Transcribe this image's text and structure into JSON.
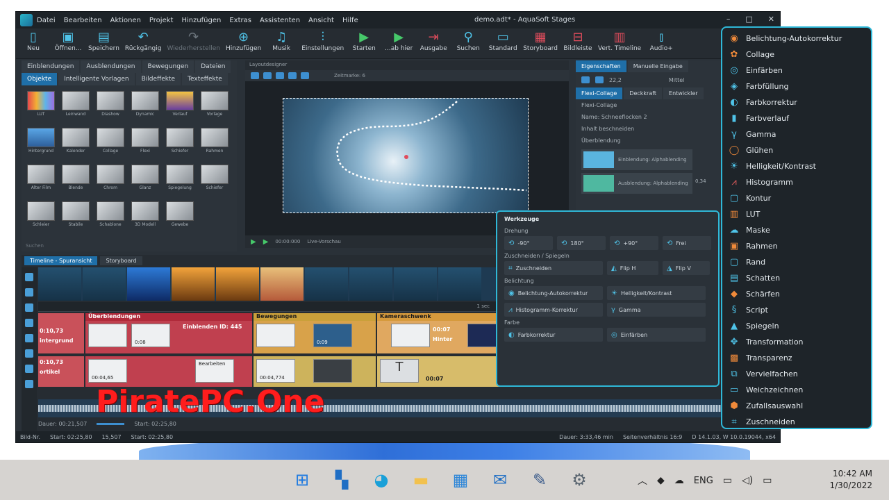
{
  "window": {
    "title": "demo.adt* - AquaSoft Stages",
    "menu": [
      "Datei",
      "Bearbeiten",
      "Aktionen",
      "Projekt",
      "Hinzufügen",
      "Extras",
      "Assistenten",
      "Ansicht",
      "Hilfe"
    ],
    "controls": [
      "–",
      "□",
      "✕"
    ]
  },
  "toolbar": [
    {
      "label": "Neu",
      "icon": "new-file-icon",
      "glyph": "▯"
    },
    {
      "label": "Öffnen...",
      "icon": "open-icon",
      "glyph": "▣"
    },
    {
      "label": "Speichern",
      "icon": "save-icon",
      "glyph": "▤"
    },
    {
      "label": "Rückgängig",
      "icon": "undo-icon",
      "glyph": "↶"
    },
    {
      "label": "Wiederherstellen",
      "icon": "redo-icon",
      "glyph": "↷",
      "dim": true
    },
    {
      "label": "Hinzufügen",
      "icon": "add-icon",
      "glyph": "⊕"
    },
    {
      "label": "Musik",
      "icon": "music-icon",
      "glyph": "♫"
    },
    {
      "label": "Einstellungen",
      "icon": "settings-icon",
      "glyph": "⫶"
    },
    {
      "label": "Starten",
      "icon": "play-icon",
      "glyph": "▶",
      "green": true
    },
    {
      "label": "...ab hier",
      "icon": "play-from-here-icon",
      "glyph": "▶",
      "green": true
    },
    {
      "label": "Ausgabe",
      "icon": "output-icon",
      "glyph": "⇥",
      "red": true
    },
    {
      "label": "Suchen",
      "icon": "search-icon",
      "glyph": "⚲"
    },
    {
      "label": "Standard",
      "icon": "standard-view-icon",
      "glyph": "▭"
    },
    {
      "label": "Storyboard",
      "icon": "storyboard-icon",
      "glyph": "▦",
      "red": true
    },
    {
      "label": "Bildleiste",
      "icon": "image-bar-icon",
      "glyph": "⊟",
      "red": true
    },
    {
      "label": "Vert. Timeline",
      "icon": "vertical-timeline-icon",
      "glyph": "▥",
      "red": true
    },
    {
      "label": "Audio+",
      "icon": "audio-plus-icon",
      "glyph": "⫾"
    }
  ],
  "object_panel": {
    "tabs_top": [
      "Einblendungen",
      "Ausblendungen",
      "Bewegungen",
      "Dateien"
    ],
    "tabs_bottom": [
      "Objekte",
      "Intelligente Vorlagen",
      "Bildeffekte",
      "Texteffekte"
    ],
    "active_tab": "Objekte",
    "thumbs": [
      {
        "label": "LUT",
        "style": "lut"
      },
      {
        "label": "Leinwand",
        "style": ""
      },
      {
        "label": "Diashow",
        "style": ""
      },
      {
        "label": "Dynamic",
        "style": ""
      },
      {
        "label": "Verlauf",
        "style": "sun"
      },
      {
        "label": "Vorlage",
        "style": ""
      },
      {
        "label": "Hintergrund",
        "style": "blue"
      },
      {
        "label": "Kalender",
        "style": ""
      },
      {
        "label": "Collage",
        "style": ""
      },
      {
        "label": "Flexi",
        "style": ""
      },
      {
        "label": "Schiefer",
        "style": ""
      },
      {
        "label": "Rahmen",
        "style": ""
      },
      {
        "label": "Alter Film",
        "style": ""
      },
      {
        "label": "Blende",
        "style": ""
      },
      {
        "label": "Chrom",
        "style": ""
      },
      {
        "label": "Glanz",
        "style": ""
      },
      {
        "label": "Spiegelung",
        "style": ""
      },
      {
        "label": "Schiefer",
        "style": ""
      },
      {
        "label": "Schleier",
        "style": ""
      },
      {
        "label": "Stabile",
        "style": ""
      },
      {
        "label": "Schablone",
        "style": ""
      },
      {
        "label": "3D Modell",
        "style": ""
      },
      {
        "label": "Gewebe",
        "style": ""
      }
    ],
    "search_placeholder": "Suchen"
  },
  "layout": {
    "header": "Layoutdesigner",
    "zoom_text": "Zeitmarke: 6",
    "time": "00:00:000",
    "preview": "Live-Vorschau"
  },
  "props": {
    "tabs": [
      "Eigenschaften",
      "Manuelle Eingabe"
    ],
    "sub_tabs": [
      "Flexi-Collage",
      "Deckkraft",
      "Entwickler"
    ],
    "value": "22,2",
    "field_mode": "Mittel",
    "section": "Flexi-Collage",
    "name_label": "Name: Schneeflocken 2",
    "checkbox": "Inhalt beschneiden",
    "blend_section": "Überblendung",
    "blend_in": "Einblendung: Alphablending",
    "blend_out": "Ausblendung: Alphablending",
    "blend_val": "0,34"
  },
  "timeline": {
    "tabs": [
      "Timeline - Spuransicht",
      "Storyboard"
    ],
    "marker": "1 sec",
    "tracks": {
      "red_left": {
        "dur": "0:10,73",
        "text": "intergrund"
      },
      "red_main": {
        "header": "Überblendungen",
        "label": "Einblenden ID: 445",
        "dur": "0:08"
      },
      "yellow": {
        "header": "Bewegungen",
        "dur": "0:09"
      },
      "orange": {
        "header": "Kameraschwenk",
        "dur": "00:07",
        "text": "Hinter"
      }
    },
    "row2": {
      "a": {
        "dur": "0:10,73",
        "text": "ortikel"
      },
      "b": {
        "dur": "00:04,65",
        "label": "Bearbeiten"
      },
      "c": {
        "dur": "00:04,774"
      },
      "d": {
        "dur": "00:07"
      }
    },
    "info": "Dauer: 00:21,507",
    "start": "Start: 02:25,80"
  },
  "statusbar": {
    "left": "Bild-Nr.",
    "mid1": "Start: 02:25,80",
    "mid2": "15,507",
    "mid3": "Start: 02:25,80",
    "dauer": "Dauer: 3:33,46 min",
    "ratio": "Seitenverhältnis 16:9",
    "version": "D 14.1.03, W 10.0.19044, x64"
  },
  "tools_panel": {
    "title": "Werkzeuge",
    "sec_rotation": "Drehung",
    "rotation": [
      "-90°",
      "180°",
      "+90°",
      "Frei"
    ],
    "sec_crop": "Zuschneiden / Spiegeln",
    "crop": [
      "Zuschneiden",
      "Flip H",
      "Flip V"
    ],
    "sec_light": "Belichtung",
    "light": [
      "Belichtung-Autokorrektur",
      "Helligkeit/Kontrast",
      "Histogramm-Korrektur",
      "Gamma"
    ],
    "sec_color": "Farbe",
    "color": [
      "Farbkorrektur",
      "Einfärben"
    ]
  },
  "effects_menu": [
    {
      "label": "Belichtung-Autokorrektur",
      "icon": "auto-exposure-icon",
      "glyph": "◉",
      "tone": "orange"
    },
    {
      "label": "Collage",
      "icon": "collage-icon",
      "glyph": "✿",
      "tone": "orange"
    },
    {
      "label": "Einfärben",
      "icon": "colorize-icon",
      "glyph": "◎",
      "tone": ""
    },
    {
      "label": "Farbfüllung",
      "icon": "color-fill-icon",
      "glyph": "◈",
      "tone": ""
    },
    {
      "label": "Farbkorrektur",
      "icon": "color-correction-icon",
      "glyph": "◐",
      "tone": ""
    },
    {
      "label": "Farbverlauf",
      "icon": "gradient-icon",
      "glyph": "▮",
      "tone": ""
    },
    {
      "label": "Gamma",
      "icon": "gamma-icon",
      "glyph": "γ",
      "tone": ""
    },
    {
      "label": "Glühen",
      "icon": "glow-icon",
      "glyph": "◯",
      "tone": "orange"
    },
    {
      "label": "Helligkeit/Kontrast",
      "icon": "brightness-icon",
      "glyph": "☀",
      "tone": ""
    },
    {
      "label": "Histogramm",
      "icon": "histogram-icon",
      "glyph": "⩘",
      "tone": "red"
    },
    {
      "label": "Kontur",
      "icon": "contour-icon",
      "glyph": "▢",
      "tone": ""
    },
    {
      "label": "LUT",
      "icon": "lut-icon",
      "glyph": "▥",
      "tone": "orange"
    },
    {
      "label": "Maske",
      "icon": "mask-icon",
      "glyph": "☁",
      "tone": ""
    },
    {
      "label": "Rahmen",
      "icon": "frame-icon",
      "glyph": "▣",
      "tone": "orange"
    },
    {
      "label": "Rand",
      "icon": "border-icon",
      "glyph": "▢",
      "tone": ""
    },
    {
      "label": "Schatten",
      "icon": "shadow-icon",
      "glyph": "▤",
      "tone": ""
    },
    {
      "label": "Schärfen",
      "icon": "sharpen-icon",
      "glyph": "◆",
      "tone": "orange"
    },
    {
      "label": "Script",
      "icon": "script-icon",
      "glyph": "§",
      "tone": ""
    },
    {
      "label": "Spiegeln",
      "icon": "mirror-icon",
      "glyph": "▲",
      "tone": ""
    },
    {
      "label": "Transformation",
      "icon": "transform-icon",
      "glyph": "✥",
      "tone": ""
    },
    {
      "label": "Transparenz",
      "icon": "transparency-icon",
      "glyph": "▩",
      "tone": "orange"
    },
    {
      "label": "Vervielfachen",
      "icon": "multiply-icon",
      "glyph": "⧉",
      "tone": ""
    },
    {
      "label": "Weichzeichnen",
      "icon": "blur-icon",
      "glyph": "▭",
      "tone": ""
    },
    {
      "label": "Zufallsauswahl",
      "icon": "random-icon",
      "glyph": "⬢",
      "tone": "orange"
    },
    {
      "label": "Zuschneiden",
      "icon": "crop-icon",
      "glyph": "⌗",
      "tone": ""
    }
  ],
  "watermark": "PiratePC.One",
  "taskbar": {
    "apps": [
      {
        "name": "windows-start-icon",
        "glyph": "⊞",
        "cls": "win"
      },
      {
        "name": "snap-layout-icon",
        "glyph": "▚",
        "cls": "snap"
      },
      {
        "name": "edge-browser-icon",
        "glyph": "◕",
        "cls": "edge"
      },
      {
        "name": "file-explorer-icon",
        "glyph": "▬",
        "cls": "folder"
      },
      {
        "name": "store-icon",
        "glyph": "▦",
        "cls": "store"
      },
      {
        "name": "mail-icon",
        "glyph": "✉",
        "cls": "mail"
      },
      {
        "name": "paint-icon",
        "glyph": "✎",
        "cls": "paint"
      },
      {
        "name": "settings-gear-icon",
        "glyph": "⚙",
        "cls": "gear"
      }
    ],
    "tray": [
      {
        "name": "chevron-up-icon",
        "glyph": "︿"
      },
      {
        "name": "security-icon",
        "glyph": "◆"
      },
      {
        "name": "cloud-icon",
        "glyph": "☁"
      }
    ],
    "lang": "ENG",
    "tray_right": [
      {
        "name": "network-icon",
        "glyph": "▭"
      },
      {
        "name": "volume-icon",
        "glyph": "◁)"
      },
      {
        "name": "battery-icon",
        "glyph": "▭"
      }
    ],
    "time": "10:42 AM",
    "date": "1/30/2022"
  }
}
